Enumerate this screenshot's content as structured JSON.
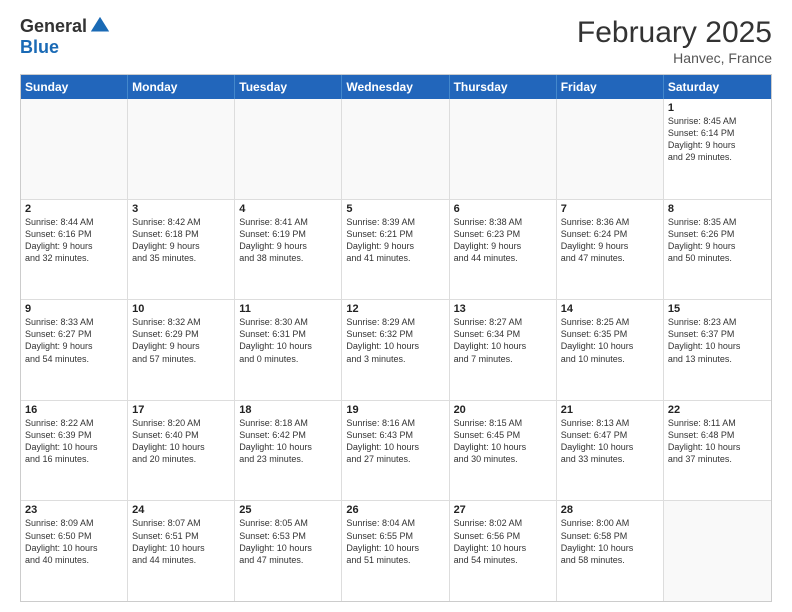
{
  "header": {
    "logo": {
      "general": "General",
      "blue": "Blue"
    },
    "title": "February 2025",
    "location": "Hanvec, France"
  },
  "days_of_week": [
    "Sunday",
    "Monday",
    "Tuesday",
    "Wednesday",
    "Thursday",
    "Friday",
    "Saturday"
  ],
  "weeks": [
    [
      {
        "day": "",
        "empty": true
      },
      {
        "day": "",
        "empty": true
      },
      {
        "day": "",
        "empty": true
      },
      {
        "day": "",
        "empty": true
      },
      {
        "day": "",
        "empty": true
      },
      {
        "day": "",
        "empty": true
      },
      {
        "day": "1",
        "lines": [
          "Sunrise: 8:45 AM",
          "Sunset: 6:14 PM",
          "Daylight: 9 hours",
          "and 29 minutes."
        ]
      }
    ],
    [
      {
        "day": "2",
        "lines": [
          "Sunrise: 8:44 AM",
          "Sunset: 6:16 PM",
          "Daylight: 9 hours",
          "and 32 minutes."
        ]
      },
      {
        "day": "3",
        "lines": [
          "Sunrise: 8:42 AM",
          "Sunset: 6:18 PM",
          "Daylight: 9 hours",
          "and 35 minutes."
        ]
      },
      {
        "day": "4",
        "lines": [
          "Sunrise: 8:41 AM",
          "Sunset: 6:19 PM",
          "Daylight: 9 hours",
          "and 38 minutes."
        ]
      },
      {
        "day": "5",
        "lines": [
          "Sunrise: 8:39 AM",
          "Sunset: 6:21 PM",
          "Daylight: 9 hours",
          "and 41 minutes."
        ]
      },
      {
        "day": "6",
        "lines": [
          "Sunrise: 8:38 AM",
          "Sunset: 6:23 PM",
          "Daylight: 9 hours",
          "and 44 minutes."
        ]
      },
      {
        "day": "7",
        "lines": [
          "Sunrise: 8:36 AM",
          "Sunset: 6:24 PM",
          "Daylight: 9 hours",
          "and 47 minutes."
        ]
      },
      {
        "day": "8",
        "lines": [
          "Sunrise: 8:35 AM",
          "Sunset: 6:26 PM",
          "Daylight: 9 hours",
          "and 50 minutes."
        ]
      }
    ],
    [
      {
        "day": "9",
        "lines": [
          "Sunrise: 8:33 AM",
          "Sunset: 6:27 PM",
          "Daylight: 9 hours",
          "and 54 minutes."
        ]
      },
      {
        "day": "10",
        "lines": [
          "Sunrise: 8:32 AM",
          "Sunset: 6:29 PM",
          "Daylight: 9 hours",
          "and 57 minutes."
        ]
      },
      {
        "day": "11",
        "lines": [
          "Sunrise: 8:30 AM",
          "Sunset: 6:31 PM",
          "Daylight: 10 hours",
          "and 0 minutes."
        ]
      },
      {
        "day": "12",
        "lines": [
          "Sunrise: 8:29 AM",
          "Sunset: 6:32 PM",
          "Daylight: 10 hours",
          "and 3 minutes."
        ]
      },
      {
        "day": "13",
        "lines": [
          "Sunrise: 8:27 AM",
          "Sunset: 6:34 PM",
          "Daylight: 10 hours",
          "and 7 minutes."
        ]
      },
      {
        "day": "14",
        "lines": [
          "Sunrise: 8:25 AM",
          "Sunset: 6:35 PM",
          "Daylight: 10 hours",
          "and 10 minutes."
        ]
      },
      {
        "day": "15",
        "lines": [
          "Sunrise: 8:23 AM",
          "Sunset: 6:37 PM",
          "Daylight: 10 hours",
          "and 13 minutes."
        ]
      }
    ],
    [
      {
        "day": "16",
        "lines": [
          "Sunrise: 8:22 AM",
          "Sunset: 6:39 PM",
          "Daylight: 10 hours",
          "and 16 minutes."
        ]
      },
      {
        "day": "17",
        "lines": [
          "Sunrise: 8:20 AM",
          "Sunset: 6:40 PM",
          "Daylight: 10 hours",
          "and 20 minutes."
        ]
      },
      {
        "day": "18",
        "lines": [
          "Sunrise: 8:18 AM",
          "Sunset: 6:42 PM",
          "Daylight: 10 hours",
          "and 23 minutes."
        ]
      },
      {
        "day": "19",
        "lines": [
          "Sunrise: 8:16 AM",
          "Sunset: 6:43 PM",
          "Daylight: 10 hours",
          "and 27 minutes."
        ]
      },
      {
        "day": "20",
        "lines": [
          "Sunrise: 8:15 AM",
          "Sunset: 6:45 PM",
          "Daylight: 10 hours",
          "and 30 minutes."
        ]
      },
      {
        "day": "21",
        "lines": [
          "Sunrise: 8:13 AM",
          "Sunset: 6:47 PM",
          "Daylight: 10 hours",
          "and 33 minutes."
        ]
      },
      {
        "day": "22",
        "lines": [
          "Sunrise: 8:11 AM",
          "Sunset: 6:48 PM",
          "Daylight: 10 hours",
          "and 37 minutes."
        ]
      }
    ],
    [
      {
        "day": "23",
        "lines": [
          "Sunrise: 8:09 AM",
          "Sunset: 6:50 PM",
          "Daylight: 10 hours",
          "and 40 minutes."
        ]
      },
      {
        "day": "24",
        "lines": [
          "Sunrise: 8:07 AM",
          "Sunset: 6:51 PM",
          "Daylight: 10 hours",
          "and 44 minutes."
        ]
      },
      {
        "day": "25",
        "lines": [
          "Sunrise: 8:05 AM",
          "Sunset: 6:53 PM",
          "Daylight: 10 hours",
          "and 47 minutes."
        ]
      },
      {
        "day": "26",
        "lines": [
          "Sunrise: 8:04 AM",
          "Sunset: 6:55 PM",
          "Daylight: 10 hours",
          "and 51 minutes."
        ]
      },
      {
        "day": "27",
        "lines": [
          "Sunrise: 8:02 AM",
          "Sunset: 6:56 PM",
          "Daylight: 10 hours",
          "and 54 minutes."
        ]
      },
      {
        "day": "28",
        "lines": [
          "Sunrise: 8:00 AM",
          "Sunset: 6:58 PM",
          "Daylight: 10 hours",
          "and 58 minutes."
        ]
      },
      {
        "day": "",
        "empty": true
      }
    ]
  ]
}
